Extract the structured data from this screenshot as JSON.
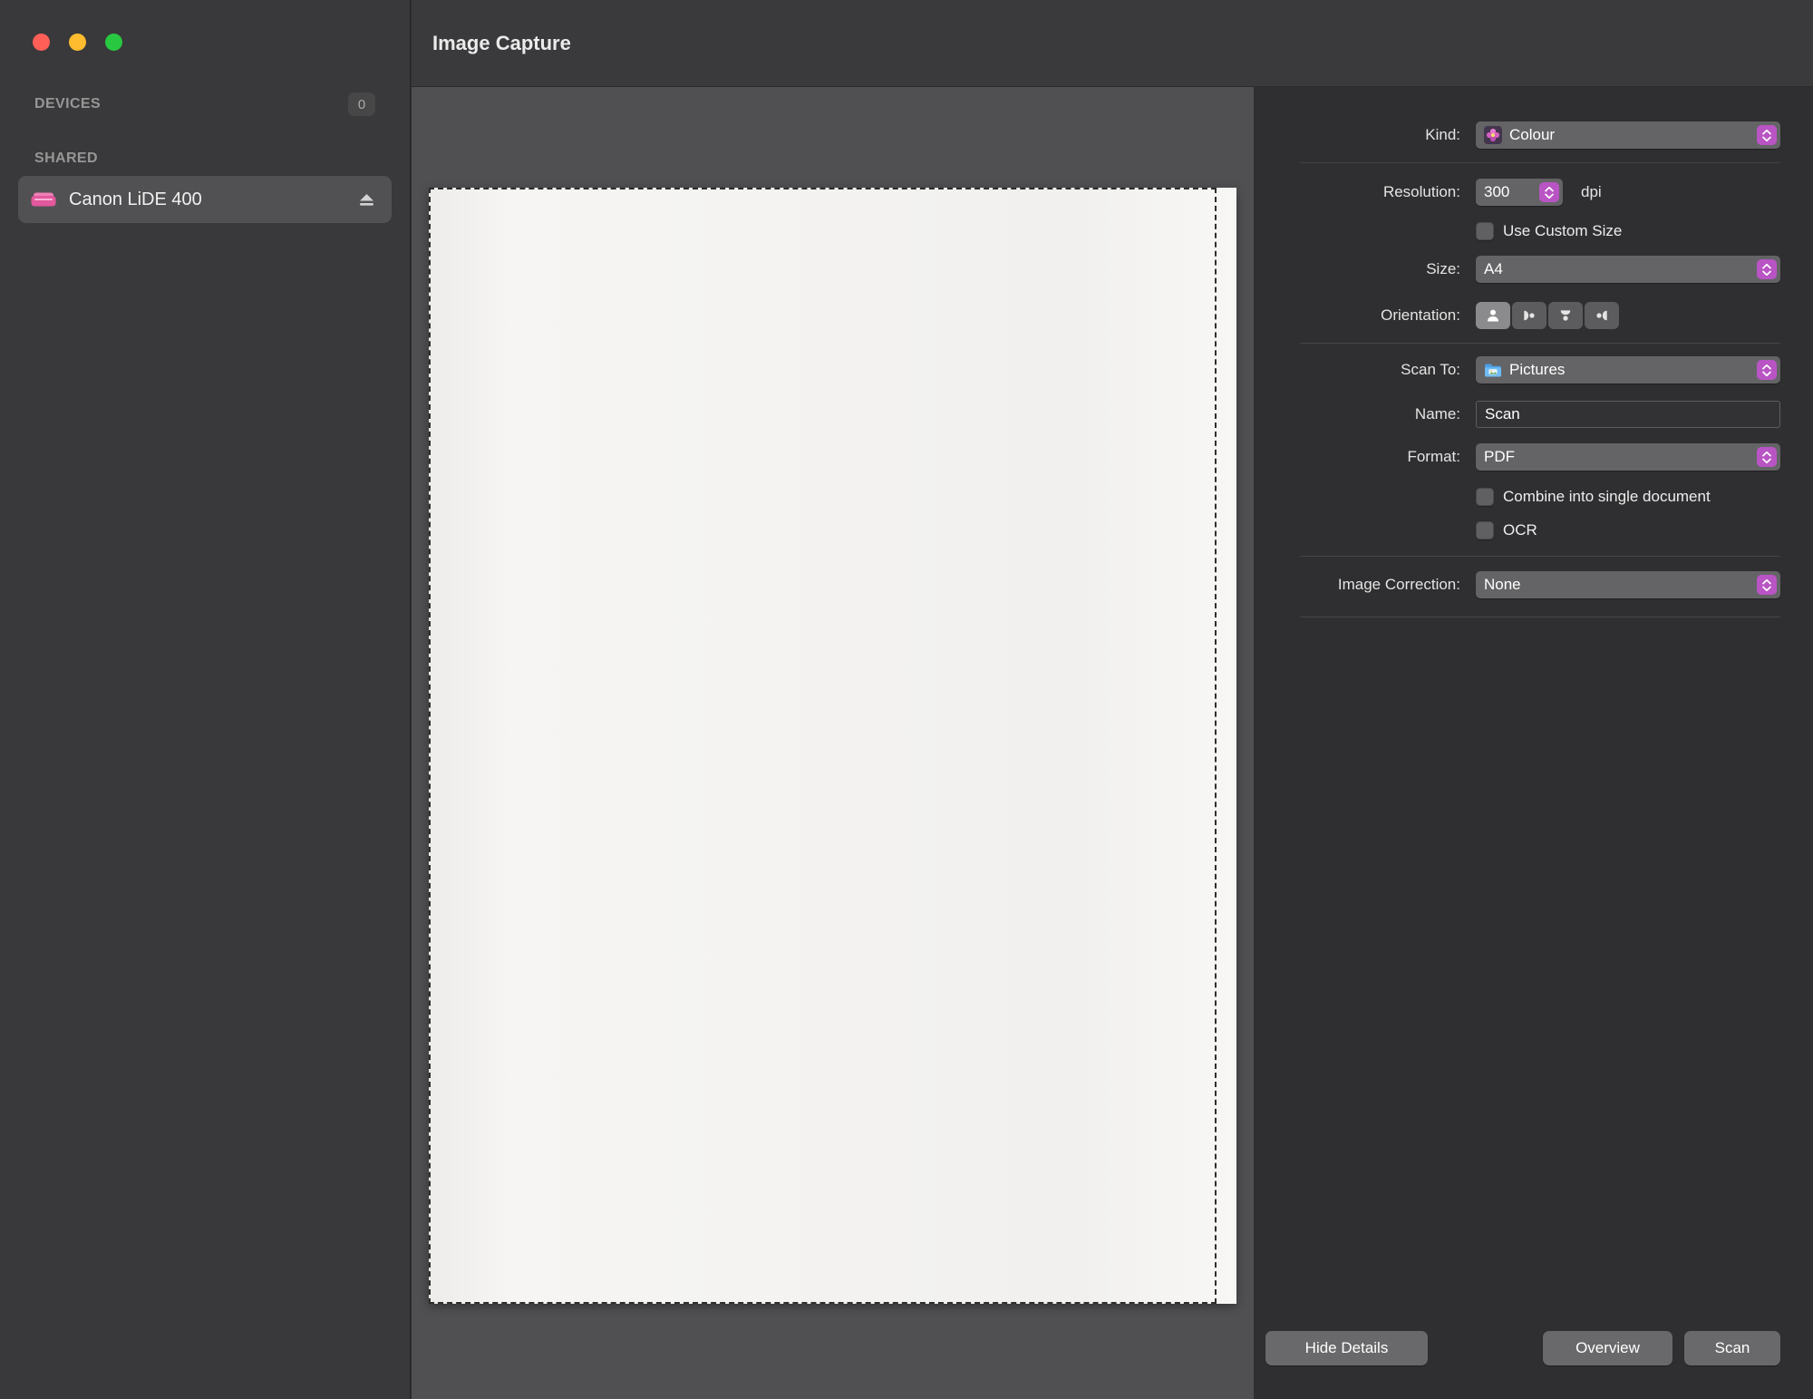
{
  "window": {
    "title": "Image Capture"
  },
  "sidebar": {
    "devices_header": "DEVICES",
    "devices_badge": "0",
    "shared_header": "SHARED",
    "device": {
      "name": "Canon LiDE 400"
    }
  },
  "panel": {
    "kind": {
      "label": "Kind:",
      "value": "Colour"
    },
    "resolution": {
      "label": "Resolution:",
      "value": "300",
      "unit": "dpi"
    },
    "use_custom_size": {
      "label": "Use Custom Size",
      "checked": false
    },
    "size": {
      "label": "Size:",
      "value": "A4"
    },
    "orientation": {
      "label": "Orientation:",
      "selected": "portrait"
    },
    "scan_to": {
      "label": "Scan To:",
      "value": "Pictures"
    },
    "name_field": {
      "label": "Name:",
      "value": "Scan"
    },
    "format": {
      "label": "Format:",
      "value": "PDF"
    },
    "combine": {
      "label": "Combine into single document",
      "checked": false
    },
    "ocr": {
      "label": "OCR",
      "checked": false
    },
    "image_correction": {
      "label": "Image Correction:",
      "value": "None"
    }
  },
  "footer": {
    "hide_details_label": "Hide Details",
    "overview_label": "Overview",
    "scan_label": "Scan"
  },
  "colors": {
    "accent": "#b954c4",
    "traffic_red": "#ff5f57",
    "traffic_yellow": "#febc2e",
    "traffic_green": "#28c840",
    "device_icon_pink": "#e2589c",
    "folder_blue": "#58a6e8"
  }
}
